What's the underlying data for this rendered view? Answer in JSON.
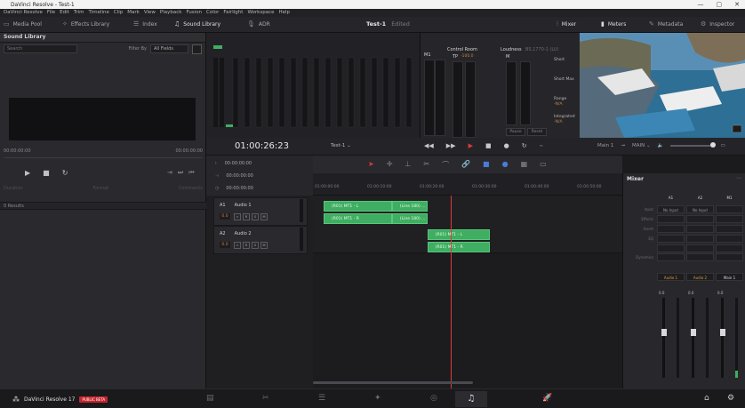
{
  "window": {
    "title": "DaVinci Resolve - Test-1",
    "controls": [
      "—",
      "▢",
      "✕"
    ]
  },
  "menu": [
    "DaVinci Resolve",
    "File",
    "Edit",
    "Trim",
    "Timeline",
    "Clip",
    "Mark",
    "View",
    "Playback",
    "Fusion",
    "Color",
    "Fairlight",
    "Workspace",
    "Help"
  ],
  "toolbar": {
    "left": [
      {
        "icon": "media-pool-icon",
        "glyph": "▭",
        "label": "Media Pool"
      },
      {
        "icon": "effects-library-icon",
        "glyph": "✧",
        "label": "Effects Library"
      },
      {
        "icon": "index-icon",
        "glyph": "☰",
        "label": "Index"
      },
      {
        "icon": "sound-library-icon",
        "glyph": "♫",
        "label": "Sound Library"
      },
      {
        "icon": "adr-icon",
        "glyph": "🎙",
        "label": "ADR"
      }
    ],
    "project": "Test-1",
    "project_status": "Edited",
    "right": [
      {
        "icon": "mixer-icon",
        "glyph": "⫶",
        "label": "Mixer"
      },
      {
        "icon": "meters-icon",
        "glyph": "▮",
        "label": "Meters"
      },
      {
        "icon": "metadata-icon",
        "glyph": "✎",
        "label": "Metadata"
      },
      {
        "icon": "inspector-icon",
        "glyph": "⚙",
        "label": "Inspector"
      }
    ]
  },
  "sound_library": {
    "title": "Sound Library",
    "search_placeholder": "Search",
    "filter_label": "Filter By",
    "filter_value": "All Fields",
    "tc_start": "00:00:00:00",
    "tc_end": "00:00:00:00",
    "labels": [
      "Duration",
      "Format",
      "Comments"
    ],
    "results": "0 Results"
  },
  "monitor": {
    "m1_label": "M1",
    "control_room_title": "Control Room",
    "tp_label": "TP",
    "tp_value": "-100.0",
    "loudness_title": "Loudness",
    "loudness_standard": "BS.1770-1 (LU)",
    "loudness_channel": "M",
    "short_label": "Short",
    "short_max_label": "Short Max",
    "range_label": "Range",
    "range_value": "-N/A",
    "integrated_label": "Integrated",
    "integrated_value": "-N/A",
    "pause_label": "Pause",
    "reset_label": "Reset"
  },
  "timeline": {
    "timecode": "01:00:26:23",
    "sequence": "Test-1",
    "bus": "Main 1",
    "bus_out": "MAIN",
    "tc_lines": [
      "00:00:00:00",
      "00:00:00:00",
      "00:00:00:00"
    ],
    "ruler": [
      "01:00:00:00",
      "01:00:10:00",
      "01:00:20:00",
      "01:00:30:00",
      "01:00:40:00",
      "01:00:50:00"
    ],
    "tracks": [
      {
        "id": "A1",
        "name": "Audio 1",
        "volume": "0.0"
      },
      {
        "id": "A2",
        "name": "Audio 2",
        "volume": "0.0"
      }
    ],
    "clips": [
      {
        "lane": 0,
        "label": "(R01) MT1 - L",
        "start": 0,
        "end": 25
      },
      {
        "lane": 0,
        "label": "(Line 180) ...",
        "start": 25,
        "end": 38
      },
      {
        "lane": 1,
        "label": "(R01) MT1 - R",
        "start": 0,
        "end": 25
      },
      {
        "lane": 1,
        "label": "(Line 180) ...",
        "start": 25,
        "end": 38
      },
      {
        "lane": 2,
        "label": "(R01) MT1 - L",
        "start": 38,
        "end": 61
      },
      {
        "lane": 3,
        "label": "(R01) MT1 - R",
        "start": 38,
        "end": 61
      }
    ],
    "playhead": 46.5
  },
  "mixer": {
    "title": "Mixer",
    "columns": [
      "A1",
      "A2",
      "M1"
    ],
    "row_labels": [
      "Input",
      "Effects",
      "Insert",
      "EQ",
      "Dynamics"
    ],
    "input_values": [
      "No Input",
      "No Input",
      ""
    ],
    "channel_names": [
      "Audio 1",
      "Audio 2",
      "Main 1"
    ],
    "fader_values": [
      "0.0",
      "0.0",
      "0.0"
    ]
  },
  "bottom": {
    "app": "DaVinci Resolve 17",
    "badge": "PUBLIC BETA",
    "pages": [
      {
        "name": "media-page-icon",
        "glyph": "▤"
      },
      {
        "name": "cut-page-icon",
        "glyph": "✂"
      },
      {
        "name": "edit-page-icon",
        "glyph": "☰"
      },
      {
        "name": "fusion-page-icon",
        "glyph": "✦"
      },
      {
        "name": "color-page-icon",
        "glyph": "◎"
      },
      {
        "name": "fairlight-page-icon",
        "glyph": "♫"
      },
      {
        "name": "deliver-page-icon",
        "glyph": "🚀"
      }
    ]
  }
}
